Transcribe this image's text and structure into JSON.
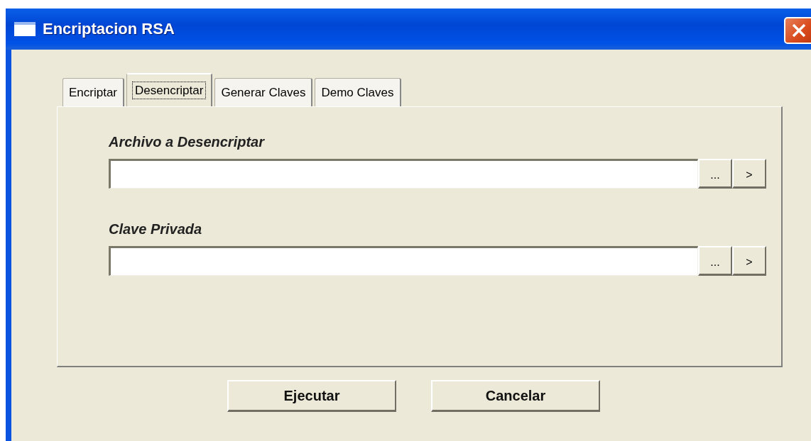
{
  "window": {
    "title": "Encriptacion RSA"
  },
  "tabs": [
    {
      "label": "Encriptar",
      "selected": false
    },
    {
      "label": "Desencriptar",
      "selected": true
    },
    {
      "label": "Generar Claves",
      "selected": false
    },
    {
      "label": "Demo Claves",
      "selected": false
    }
  ],
  "fields": [
    {
      "label": "Archivo a Desencriptar",
      "browse_button": "...",
      "go_button": ">"
    },
    {
      "label": "Clave Privada",
      "browse_button": "...",
      "go_button": ">"
    }
  ],
  "buttons": [
    "Ejecutar",
    "Cancelar"
  ]
}
